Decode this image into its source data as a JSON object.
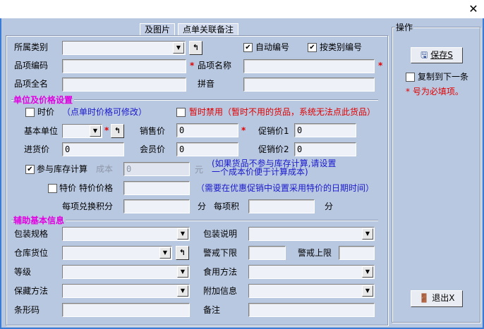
{
  "window": {
    "close_label": "✕"
  },
  "tabs": [
    {
      "label": "及图片"
    },
    {
      "label": "点单关联备注"
    }
  ],
  "basic": {
    "category_label": "所属类别",
    "auto_number_label": "自动编号",
    "by_category_label": "按类别编号",
    "code_label": "品项编码",
    "name_label": "品项名称",
    "fullname_label": "品项全名",
    "pinyin_label": "拼音",
    "auto_number_checked": true,
    "by_category_checked": true
  },
  "price_section": {
    "title": "单位及价格设置",
    "time_price_label": "时价",
    "time_price_note": "（点单时价格可修改）",
    "disable_label": "暂时禁用（暂时不用的货品，系统无法点此货品）",
    "unit_label": "基本单位",
    "sale_price_label": "销售价",
    "sale_price": "0",
    "promo1_label": "促销价1",
    "promo1": "0",
    "purchase_label": "进货价",
    "purchase": "0",
    "member_label": "会员价",
    "member": "0",
    "promo2_label": "促销价2",
    "promo2": "0",
    "stock_calc_label": "参与库存计算",
    "stock_calc_checked": true,
    "cost_label": "成本",
    "cost": "0",
    "yuan_label": "元",
    "cost_note_1": "(如果货品不参与库存计算,请设置",
    "cost_note_2": "一个成本价便于计算成本)",
    "special_label": "特价",
    "special_price_label": "特价价格",
    "special_note": "（需要在优惠促销中设置采用特价的日期时间）",
    "points_label": "每项兑换积分",
    "points_unit": "分",
    "per_item_label": "每项积",
    "per_item_unit": "分"
  },
  "aux_section": {
    "title": "辅助基本信息",
    "pack_spec_label": "包装规格",
    "pack_desc_label": "包装说明",
    "location_label": "仓库货位",
    "min_label": "警戒下限",
    "max_label": "警戒上限",
    "grade_label": "等级",
    "usage_label": "食用方法",
    "storage_label": "保藏方法",
    "extra_label": "附加信息",
    "barcode_label": "条形码",
    "remark_label": "备注"
  },
  "actions": {
    "title": "操作",
    "save_label": "保存S",
    "copy_label": "复制到下一条",
    "required_note": "* 号为必填项。",
    "exit_label": "退出X"
  },
  "colors": {
    "background": "#b9c8e1",
    "section": "#e000e0",
    "note": "#1a1acc",
    "required": "#e00000"
  }
}
